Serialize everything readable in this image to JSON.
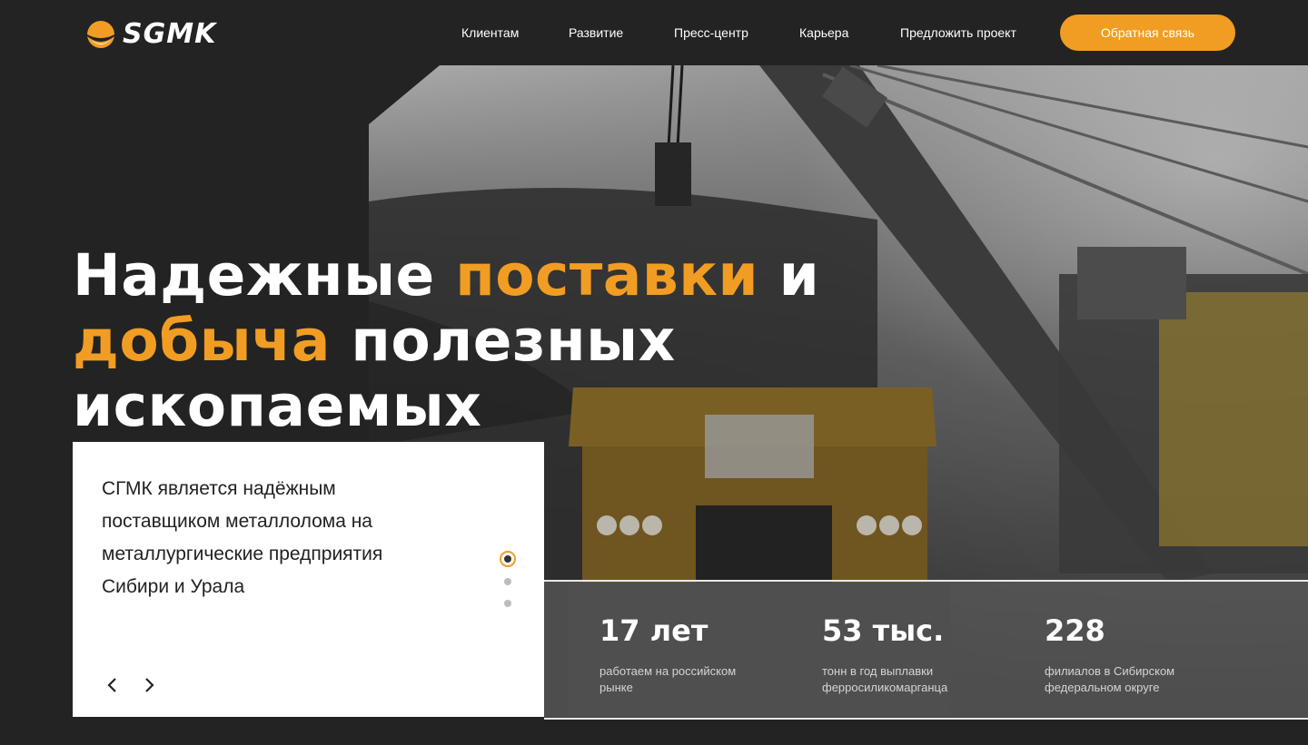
{
  "header": {
    "logo_text": "SGMK",
    "nav": [
      "Клиентам",
      "Развитие",
      "Пресс-центр",
      "Карьера",
      "Предложить проект"
    ],
    "cta_label": "Обратная связь"
  },
  "hero": {
    "headline": {
      "w1": "Надежные",
      "w2": "поставки",
      "w3": "и",
      "w4": "добыча",
      "w5": "полезных ископаемых"
    },
    "card_text": "СГМК является надёжным поставщиком металлолома на металлургические предприятия Сибири и Урала",
    "slider": {
      "total": 3,
      "active": 1
    }
  },
  "stats": [
    {
      "value": "17 лет",
      "label": "работаем на российском рынке"
    },
    {
      "value": "53 тыс.",
      "label": "тонн в год выплавки ферросиликомарганца"
    },
    {
      "value": "228",
      "label": "филиалов в Сибирском федеральном округе"
    }
  ],
  "colors": {
    "accent": "#f19d23",
    "background": "#232323",
    "card": "#ffffff"
  }
}
